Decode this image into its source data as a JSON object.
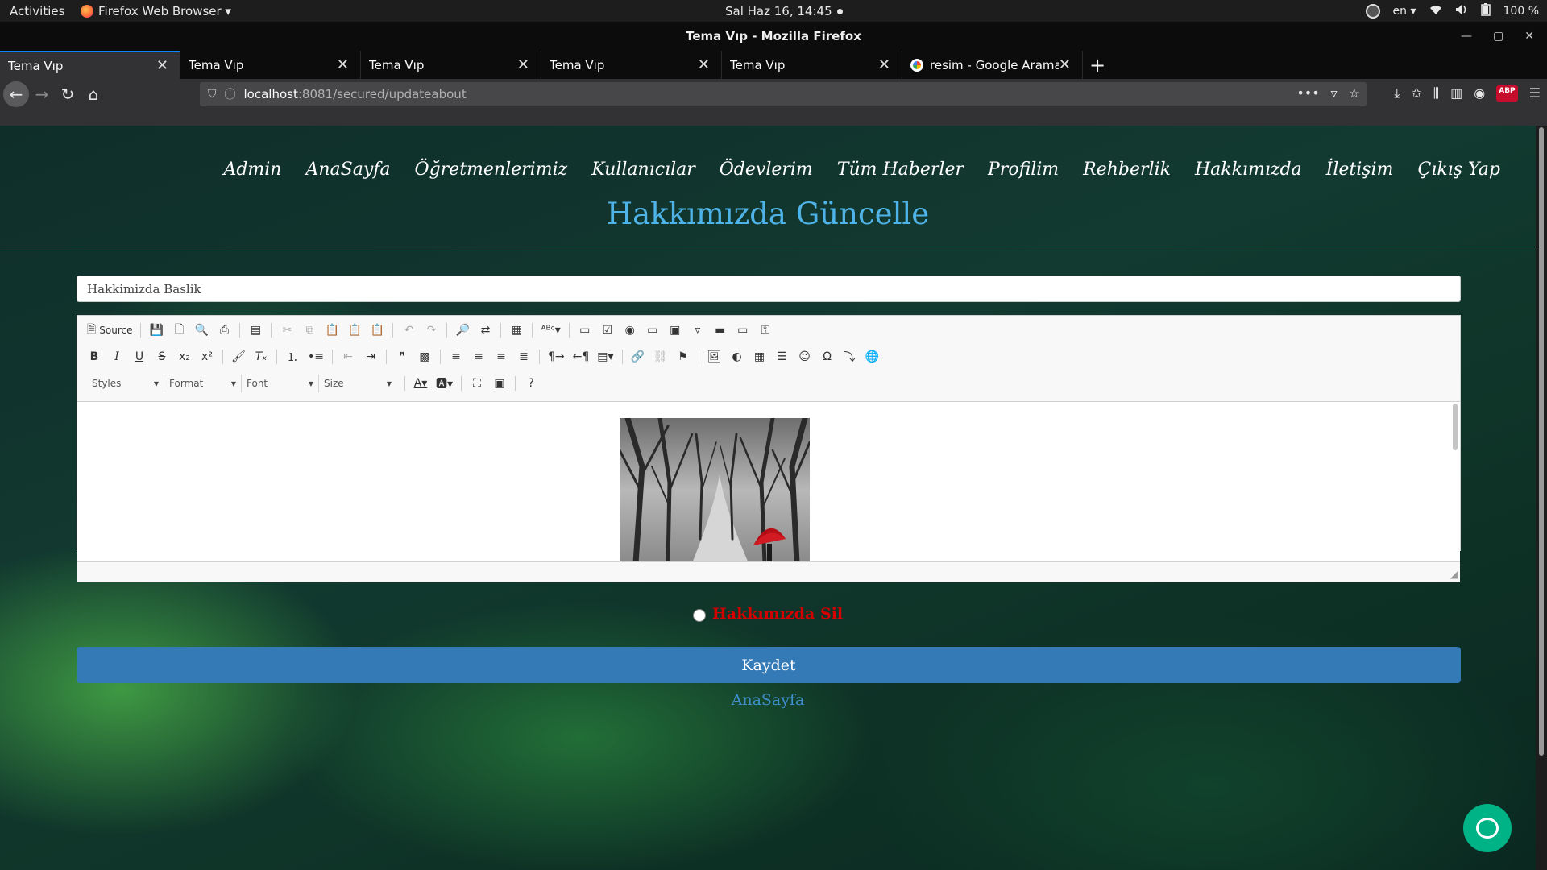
{
  "gnome": {
    "activities": "Activities",
    "app_menu": "Firefox Web Browser ▾",
    "clock": "Sal Haz 16, 14:45",
    "language": "en ▾",
    "battery": "100 %"
  },
  "window": {
    "title": "Tema Vıp - Mozilla Firefox"
  },
  "tabs": [
    {
      "label": "Tema Vıp",
      "active": true
    },
    {
      "label": "Tema Vıp",
      "active": false
    },
    {
      "label": "Tema Vıp",
      "active": false
    },
    {
      "label": "Tema Vıp",
      "active": false
    },
    {
      "label": "Tema Vıp",
      "active": false
    },
    {
      "label": "resim - Google Arama",
      "active": false
    }
  ],
  "urlbar": {
    "host": "localhost",
    "path": ":8081/secured/updateabout"
  },
  "site": {
    "nav": [
      "Admin",
      "AnaSayfa",
      "Öğretmenlerimiz",
      "Kullanıcılar",
      "Ödevlerim",
      "Tüm Haberler",
      "Profilim",
      "Rehberlik",
      "Hakkımızda",
      "İletişim",
      "Çıkış Yap"
    ],
    "page_title": "Hakkımızda Güncelle",
    "title_field_value": "Hakkimizda Baslik",
    "editor": {
      "source_label": "Source",
      "styles_label": "Styles",
      "format_label": "Format",
      "font_label": "Font",
      "size_label": "Size"
    },
    "delete_label": "Hakkımızda Sil",
    "save_label": "Kaydet",
    "home_link": "AnaSayfa"
  },
  "colors": {
    "accent_title": "#4fb3e8",
    "save_button": "#337ab7",
    "delete_text": "#d40000",
    "chat": "#00b386"
  }
}
